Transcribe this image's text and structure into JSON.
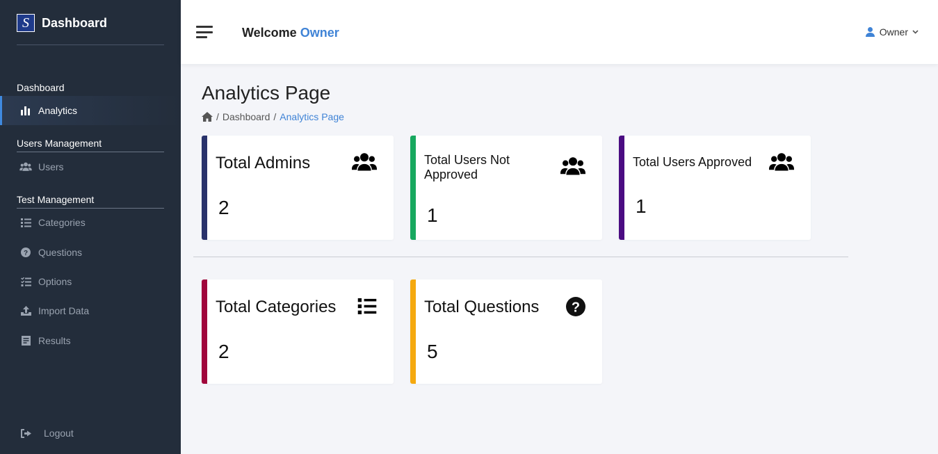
{
  "brand": {
    "logo_letter": "S",
    "title": "Dashboard"
  },
  "sidebar": {
    "sections": [
      {
        "label": "Dashboard"
      },
      {
        "label": "Users Management"
      },
      {
        "label": "Test Management"
      }
    ],
    "items": [
      {
        "label": "Analytics",
        "icon": "bar-chart-icon",
        "active": true
      },
      {
        "label": "Users",
        "icon": "users-icon"
      },
      {
        "label": "Categories",
        "icon": "list-icon"
      },
      {
        "label": "Questions",
        "icon": "question-circle-icon"
      },
      {
        "label": "Options",
        "icon": "checklist-icon"
      },
      {
        "label": "Import Data",
        "icon": "upload-icon"
      },
      {
        "label": "Results",
        "icon": "report-icon"
      },
      {
        "label": "Logout",
        "icon": "logout-icon"
      }
    ]
  },
  "header": {
    "welcome_prefix": "Welcome",
    "welcome_name": "Owner",
    "user_name": "Owner",
    "accent_color": "#3f83d6"
  },
  "page": {
    "title": "Analytics Page",
    "breadcrumb": {
      "sep": "/",
      "parent": "Dashboard",
      "current": "Analytics Page"
    }
  },
  "cards": [
    {
      "label": "Total Admins",
      "value": "2",
      "color": "#29326b",
      "icon": "users-icon"
    },
    {
      "label": "Total Users Not Approved",
      "value": "1",
      "color": "#17a85f",
      "icon": "users-icon"
    },
    {
      "label": "Total Users Approved",
      "value": "1",
      "color": "#4b0c82",
      "icon": "users-icon"
    },
    {
      "label": "Total Categories",
      "value": "2",
      "color": "#a0063c",
      "icon": "list-icon"
    },
    {
      "label": "Total Questions",
      "value": "5",
      "color": "#f5a90f",
      "icon": "question-circle-icon"
    }
  ]
}
